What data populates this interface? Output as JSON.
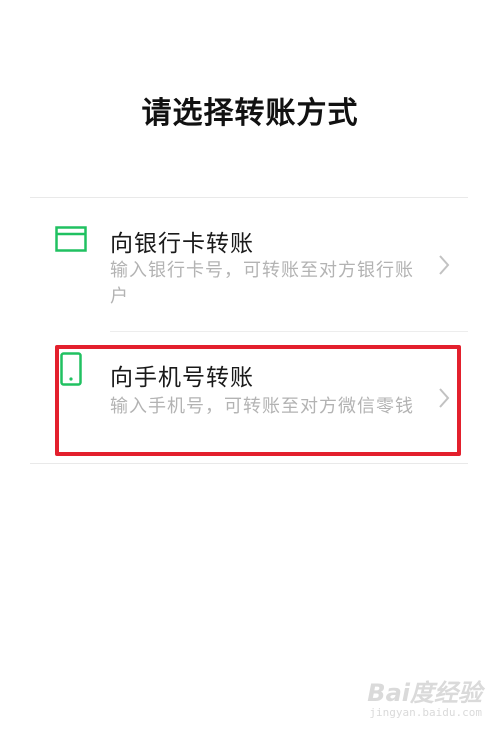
{
  "page": {
    "title": "请选择转账方式"
  },
  "options": [
    {
      "title": "向银行卡转账",
      "description": "输入银行卡号，可转账至对方银行账户",
      "icon": "bank-card-icon",
      "chevron": "chevron-right-icon"
    },
    {
      "title": "向手机号转账",
      "description": "输入手机号，可转账至对方微信零钱",
      "icon": "mobile-phone-icon",
      "chevron": "chevron-right-icon",
      "highlighted": true
    }
  ],
  "colors": {
    "icon_green": "#20c161",
    "highlight_red": "#e3202d",
    "desc_gray": "#b3b3b3"
  },
  "watermark": {
    "logo": "Bai度经验",
    "url": "jingyan.baidu.com"
  }
}
